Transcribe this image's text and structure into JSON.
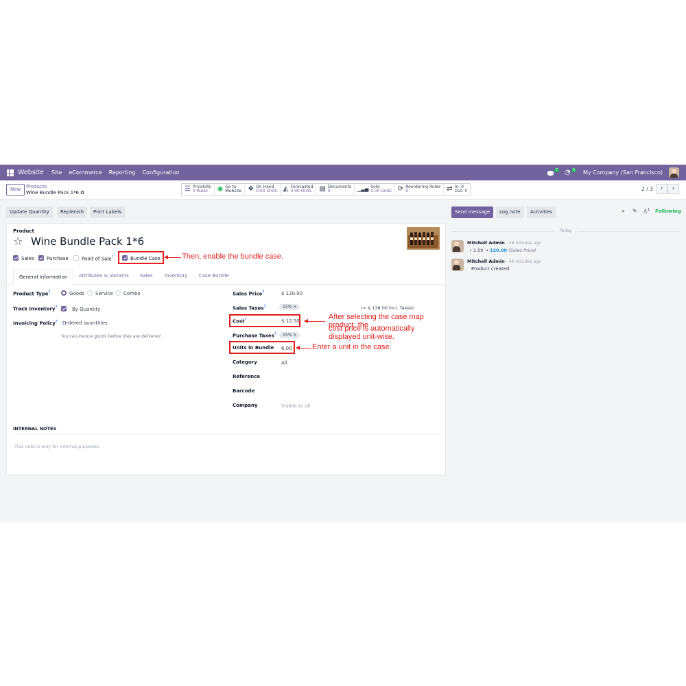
{
  "navbar": {
    "brand": "Website",
    "menu": [
      "Site",
      "eCommerce",
      "Reporting",
      "Configuration"
    ],
    "messages_count": "7",
    "activities_count": "5",
    "company": "My Company (San Francisco)"
  },
  "control": {
    "new_label": "New",
    "breadcrumb_parent": "Products",
    "breadcrumb_current": "Wine Bundle Pack 1*6",
    "stats": [
      {
        "icon": "list-icon",
        "glyph": "☰",
        "line1": "Pricelists",
        "line2": "0 Rules"
      },
      {
        "icon": "globe-icon",
        "glyph": "◉",
        "line1": "Go to",
        "line2": "Website"
      },
      {
        "icon": "cubes-icon",
        "glyph": "❖",
        "line1": "On Hand",
        "line2": "0.00 Units"
      },
      {
        "icon": "area-chart-icon",
        "glyph": "◭",
        "line1": "Forecasted",
        "line2": "0.00 Units"
      },
      {
        "icon": "document-icon",
        "glyph": "▤",
        "line1": "Documents",
        "line2": "0"
      },
      {
        "icon": "bar-chart-icon",
        "glyph": "▁▃▅",
        "line1": "Sold",
        "line2": "0.00 Units"
      },
      {
        "icon": "refresh-icon",
        "glyph": "⟳",
        "line1": "Reordering Rules",
        "line2": "0"
      },
      {
        "icon": "exchange-icon",
        "glyph": "⇄",
        "line1": "In: 0",
        "line2": "Out: 0"
      }
    ],
    "pager": "2 / 3"
  },
  "actions": [
    "Update Quantity",
    "Replenish",
    "Print Labels"
  ],
  "form": {
    "type_label": "Product",
    "name": "Wine Bundle Pack 1*6",
    "flags": {
      "sales": "Sales",
      "purchase": "Purchase",
      "pos": "Point of Sale",
      "bundle": "Bundle Case"
    },
    "tabs": [
      "General Information",
      "Attributes & Variants",
      "Sales",
      "Inventory",
      "Case Bundle"
    ],
    "product_type_label": "Product Type",
    "product_type_options": [
      "Goods",
      "Service",
      "Combo"
    ],
    "track_inventory_label": "Track Inventory",
    "track_inventory_value": "By Quantity",
    "invoicing_policy_label": "Invoicing Policy",
    "invoicing_policy_value": "Ordered quantities",
    "invoicing_hint": "You can invoice goods before they are delivered.",
    "sales_price_label": "Sales Price",
    "sales_price": "$ 120.00",
    "sales_taxes_label": "Sales Taxes",
    "sales_taxes_tag": "15%",
    "sales_taxes_incl": "(= $ 138.00 Incl. Taxes)",
    "cost_label": "Cost",
    "cost": "$ 12.50",
    "purchase_taxes_label": "Purchase Taxes",
    "purchase_taxes_tag": "15%",
    "units_label": "Units in Bundle",
    "units": "6.00",
    "category_label": "Category",
    "category": "All",
    "reference_label": "Reference",
    "barcode_label": "Barcode",
    "company_label": "Company",
    "company_placeholder": "Visible to all",
    "notes_title": "INTERNAL NOTES",
    "notes_placeholder": "This note is only for internal purposes."
  },
  "annotations": {
    "bundle": "Then, enable the bundle case.",
    "cost_line1": "After selecting the case map product, the",
    "cost_line2": "cost price is automatically displayed unit-wise.",
    "units": "Enter a unit in the case."
  },
  "chatter": {
    "send_message": "Send message",
    "log_note": "Log note",
    "activities": "Activities",
    "followers_count": "1",
    "following": "Following",
    "today": "Today",
    "messages": [
      {
        "author": "Mitchell Admin",
        "time": "- 38 minutes ago",
        "old": "1.00",
        "arrow": "→",
        "new": "120.00",
        "field": "(Sales Price)"
      },
      {
        "author": "Mitchell Admin",
        "time": "- 46 minutes ago",
        "text": "Product created"
      }
    ]
  },
  "colors": {
    "brand": "#71639e",
    "annotation": "#e11d1d",
    "following": "#1eb75a"
  }
}
